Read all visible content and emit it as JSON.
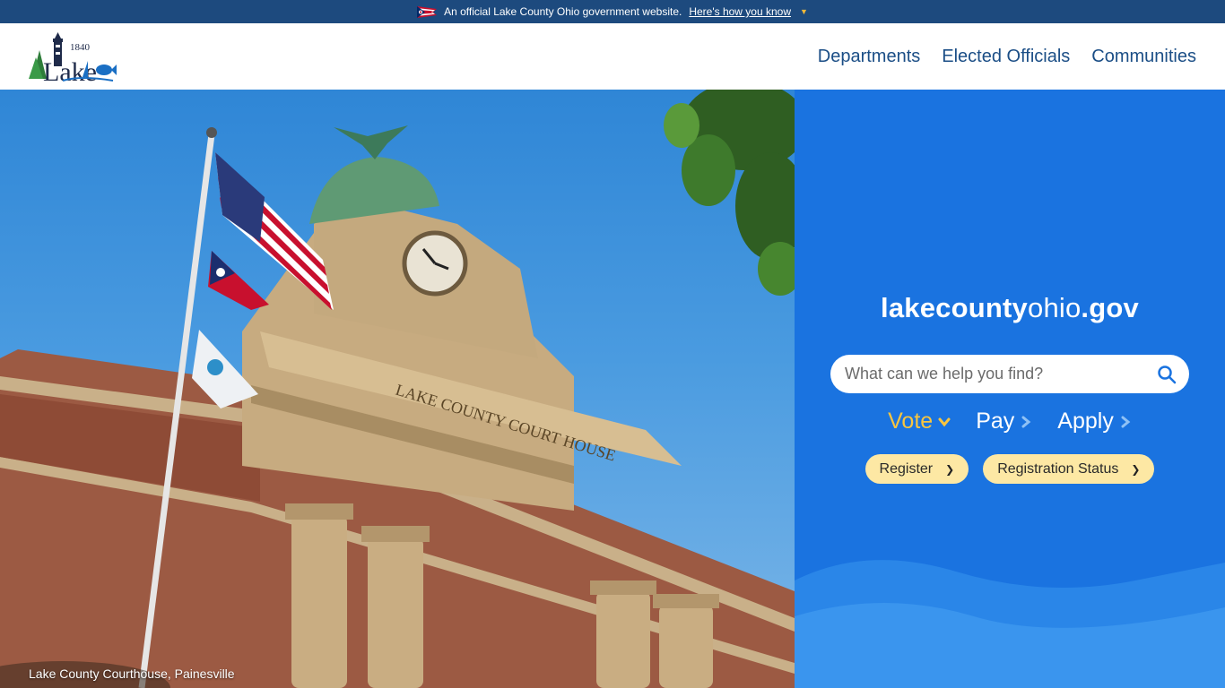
{
  "banner": {
    "text": "An official Lake County Ohio government website.",
    "link": "Here's how you know"
  },
  "header": {
    "logo_year": "1840",
    "logo_text": "Lake",
    "nav": [
      "Departments",
      "Elected Officials",
      "Communities"
    ]
  },
  "hero": {
    "caption": "Lake County Courthouse, Painesville",
    "building_inscription": "LAKE COUNTY COURT HOUSE"
  },
  "panel": {
    "site_name_bold_1": "lakecounty",
    "site_name_light": "ohio",
    "site_name_bold_2": ".gov",
    "search_placeholder": "What can we help you find?",
    "tabs": [
      {
        "label": "Vote",
        "active": true
      },
      {
        "label": "Pay",
        "active": false
      },
      {
        "label": "Apply",
        "active": false
      }
    ],
    "pills": [
      "Register",
      "Registration Status"
    ]
  },
  "colors": {
    "banner_bg": "#1d4a7e",
    "nav_text": "#1b4e86",
    "panel_bg": "#1a73e0",
    "active_tab": "#f8c53f",
    "pill_bg": "#fde8a4"
  }
}
